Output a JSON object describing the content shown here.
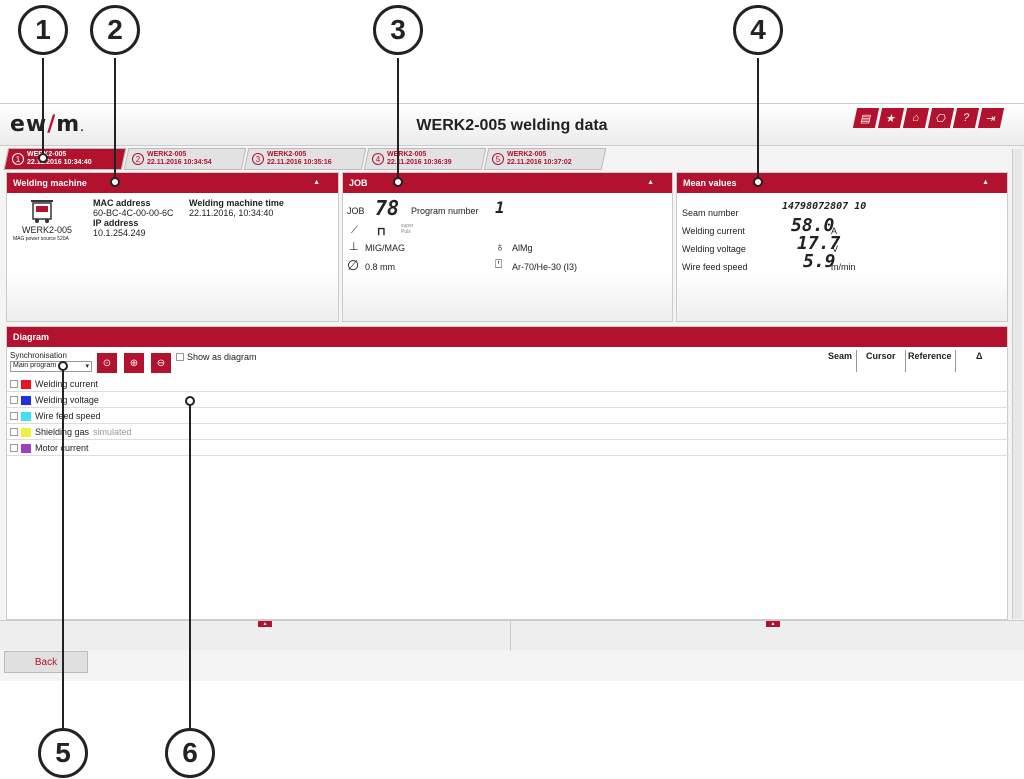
{
  "callouts": [
    "1",
    "2",
    "3",
    "4",
    "5",
    "6"
  ],
  "app": {
    "logo_pre": "ew",
    "logo_slash": "/",
    "logo_post": "m",
    "logo_dot": ".",
    "title": "WERK2-005 welding data",
    "toolbar_icons": [
      "print-icon",
      "star-icon",
      "home-icon",
      "network-icon",
      "help-icon",
      "exit-icon"
    ],
    "toolbar_glyphs": [
      "▤",
      "★",
      "⌂",
      "⎔",
      "?",
      "⇥"
    ]
  },
  "tabs": [
    {
      "num": "1",
      "name": "WERK2-005",
      "time": "22.11.2016 10:34:40"
    },
    {
      "num": "2",
      "name": "WERK2-005",
      "time": "22.11.2016 10:34:54"
    },
    {
      "num": "3",
      "name": "WERK2-005",
      "time": "22.11.2016 10:35:16"
    },
    {
      "num": "4",
      "name": "WERK2-005",
      "time": "22.11.2016 10:36:39"
    },
    {
      "num": "5",
      "name": "WERK2-005",
      "time": "22.11.2016 10:37:02"
    }
  ],
  "welding_machine": {
    "header": "Welding machine",
    "name": "WERK2-005",
    "sub": "MAG power source 520A",
    "mac_label": "MAC address",
    "mac_value": "60-BC-4C-00-00-6C",
    "ip_label": "IP address",
    "ip_value": "10.1.254.249",
    "time_label": "Welding machine time",
    "time_value": "22.11.2016, 10:34:40"
  },
  "job": {
    "header": "JOB",
    "job_label": "JOB",
    "job_value": "78",
    "program_label": "Program number",
    "program_value": "1",
    "process": "MIG/MAG",
    "material": "AlMg",
    "diameter": "0.8 mm",
    "gas": "Ar-70/He-30 (I3)",
    "superpuls": "super Puls"
  },
  "mean_values": {
    "header": "Mean values",
    "seam_label": "Seam number",
    "seam_value": "14798072807 10",
    "current_label": "Welding current",
    "current_value": "58.0",
    "current_unit": "A",
    "voltage_label": "Welding voltage",
    "voltage_value": "17.7",
    "voltage_unit": "V",
    "wfs_label": "Wire feed speed",
    "wfs_value": "5.9",
    "wfs_unit": "m/min"
  },
  "diagram": {
    "header": "Diagram",
    "sync_label": "Synchronisation",
    "sync_value": "Main program",
    "show_as_diagram": "Show as diagram",
    "columns": [
      "Seam",
      "Cursor",
      "Reference",
      "Δ"
    ],
    "channels": [
      {
        "name": "Welding current",
        "color": "#e8141e",
        "note": ""
      },
      {
        "name": "Welding voltage",
        "color": "#2030e0",
        "note": ""
      },
      {
        "name": "Wire feed speed",
        "color": "#40e0f0",
        "note": ""
      },
      {
        "name": "Shielding gas",
        "color": "#f0f040",
        "note": "simulated"
      },
      {
        "name": "Motor current",
        "color": "#a040c0",
        "note": ""
      }
    ]
  },
  "back_label": "Back"
}
